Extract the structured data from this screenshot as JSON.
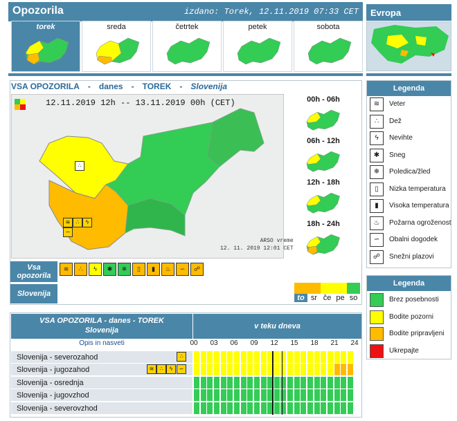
{
  "header": {
    "title": "Opozorila",
    "issued": "izdano: Torek, 12.11.2019 07:33 CET",
    "europe": "Evropa"
  },
  "days": [
    {
      "label": "torek",
      "selected": true
    },
    {
      "label": "sreda"
    },
    {
      "label": "četrtek"
    },
    {
      "label": "petek"
    },
    {
      "label": "sobota"
    }
  ],
  "panel": {
    "title_parts": [
      "VSA OPOZORILA",
      "-",
      "danes",
      "-",
      "TOREK",
      "-",
      "Slovenija"
    ],
    "map_date": "12.11.2019 12h -- 13.11.2019 00h    (CET)",
    "credit_line1": "ARSO vreme",
    "credit_line2": "12. 11. 2019  12:01 CET",
    "slots": [
      "00h - 06h",
      "06h - 12h",
      "12h - 18h",
      "18h - 24h"
    ],
    "vsa_label": "Vsa opozorila",
    "slovenija_label": "Slovenija",
    "weekday_scale": [
      "to",
      "sr",
      "če",
      "pe",
      "so"
    ]
  },
  "legend": {
    "title": "Legenda",
    "items": [
      {
        "label": "Veter",
        "icon": "wind-icon",
        "glyph": "≋"
      },
      {
        "label": "Dež",
        "icon": "rain-icon",
        "glyph": "∴"
      },
      {
        "label": "Nevihte",
        "icon": "thunderstorm-icon",
        "glyph": "ϟ"
      },
      {
        "label": "Sneg",
        "icon": "snow-icon",
        "glyph": "✱"
      },
      {
        "label": "Poledica/žled",
        "icon": "ice-icon",
        "glyph": "❄"
      },
      {
        "label": "Nizka temperatura",
        "icon": "low-temperature-icon",
        "glyph": "▯"
      },
      {
        "label": "Visoka temperatura",
        "icon": "high-temperature-icon",
        "glyph": "▮"
      },
      {
        "label": "Požarna ogroženost",
        "icon": "fire-icon",
        "glyph": "♨"
      },
      {
        "label": "Obalni dogodek",
        "icon": "coastal-event-icon",
        "glyph": "∽"
      },
      {
        "label": "Snežni plazovi",
        "icon": "avalanche-icon",
        "glyph": "☍"
      }
    ],
    "colors_title": "Legenda",
    "colors": [
      {
        "label": "Brez posebnosti",
        "color": "#33cc55"
      },
      {
        "label": "Bodite pozorni",
        "color": "#ffff00"
      },
      {
        "label": "Bodite pripravljeni",
        "color": "#ffbb00"
      },
      {
        "label": "Ukrepajte",
        "color": "#ee1111"
      }
    ]
  },
  "table": {
    "title": "VSA OPOZORILA - danes - TOREK",
    "subtitle": "Slovenija",
    "time_header": "v teku dneva",
    "opis": "Opis in nasveti",
    "hours": [
      "00",
      "03",
      "06",
      "09",
      "12",
      "15",
      "18",
      "21",
      "24"
    ],
    "rows": [
      {
        "name": "Slovenija - severozahod",
        "cells": "yyyyyyyyyyyyyyyyyyyyyyyy"
      },
      {
        "name": "Slovenija - jugozahod",
        "cells": "yyyyyyyyyyyyyyyyyyyyyooo"
      },
      {
        "name": "Slovenija - osrednja",
        "cells": "gggggggggggggggggggggggg"
      },
      {
        "name": "Slovenija - jugovzhod",
        "cells": "gggggggggggggggggggggggg"
      },
      {
        "name": "Slovenija - severovzhod",
        "cells": "gggggggggggggggggggggggg"
      }
    ]
  }
}
